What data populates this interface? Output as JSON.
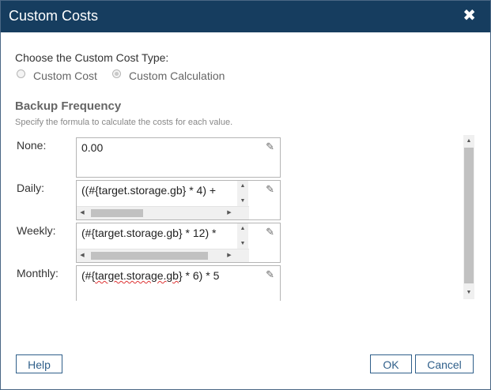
{
  "dialog": {
    "title": "Custom Costs",
    "close_glyph": "✖"
  },
  "cost_type": {
    "prompt": "Choose the Custom Cost Type:",
    "options": [
      {
        "label": "Custom Cost",
        "selected": false
      },
      {
        "label": "Custom Calculation",
        "selected": true
      }
    ]
  },
  "section": {
    "title": "Backup Frequency",
    "description": "Specify the formula to calculate the costs for each value."
  },
  "fields": [
    {
      "label": "None:",
      "value": "0.00"
    },
    {
      "label": "Daily:",
      "value": "((#{target.storage.gb} * 4) +"
    },
    {
      "label": "Weekly:",
      "value": "(#{target.storage.gb} * 12) *"
    },
    {
      "label": "Monthly:",
      "value_prefix": "(#{",
      "value_underlined": "target.storage.gb",
      "value_suffix": "} * 6) * 5"
    }
  ],
  "buttons": {
    "help": "Help",
    "ok": "OK",
    "cancel": "Cancel"
  },
  "icons": {
    "edit": "pencil-icon",
    "close": "close-icon"
  },
  "colors": {
    "titlebar": "#163d5f",
    "button_border": "#2f5f8a"
  }
}
